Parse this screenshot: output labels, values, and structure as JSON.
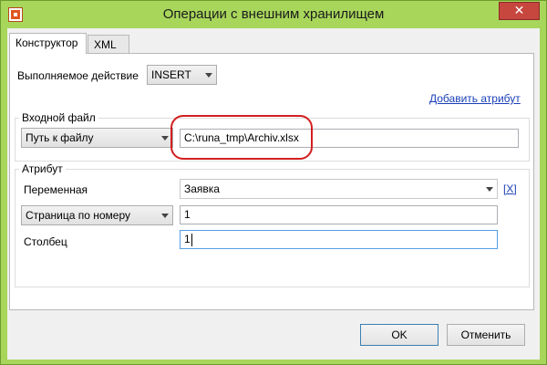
{
  "window": {
    "title": "Операции с внешним хранилищем",
    "close_label": "✕"
  },
  "tabs": [
    {
      "label": "Конструктор",
      "active": true
    },
    {
      "label": "XML",
      "active": false
    }
  ],
  "action": {
    "label": "Выполняемое действие",
    "value": "INSERT"
  },
  "add_attribute_link": "Добавить атрибут",
  "input_file": {
    "group_title": "Входной файл",
    "mode": "Путь к файлу",
    "path": "C:\\runa_tmp\\Archiv.xlsx"
  },
  "attribute": {
    "group_title": "Атрибут",
    "variable_label": "Переменная",
    "variable_value": "Заявка",
    "remove_link": "[X]",
    "page_mode": "Страница по номеру",
    "page_value": "1",
    "column_label": "Столбец",
    "column_value": "1"
  },
  "buttons": {
    "ok": "OK",
    "cancel": "Отменить"
  }
}
